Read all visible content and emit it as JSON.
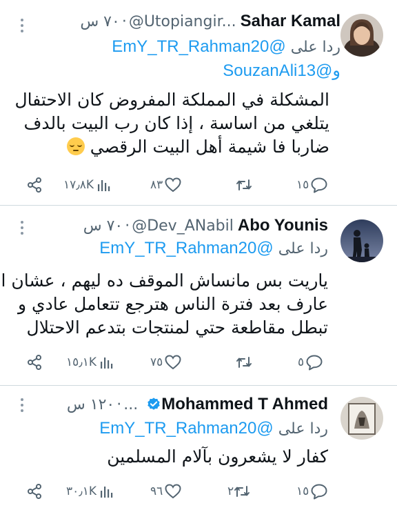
{
  "reply_prefix": "ردا على",
  "tweets": [
    {
      "name": "Sahar Kamal",
      "handle": "@Utopiangir...",
      "time": "٧٠ س",
      "verified": false,
      "reply_to": [
        "@EmY_TR_Rahman20",
        "و@SouzanAli13"
      ],
      "lines": [
        "المشكلة في المملكة المفروض كان الاحتفال",
        "يتلغي من اساسة ، إذا كان رب البيت بالدف",
        "ضاربا فا شيمة أهل البيت الرقصي"
      ],
      "emoji": "pensive-face-emoji",
      "views": "١٧٫٨K",
      "likes": "٨٣",
      "retweets": "",
      "replies": "١٥"
    },
    {
      "name": "Abo Younis",
      "handle": "@Dev_ANabil",
      "time": "٧٠ س",
      "verified": false,
      "reply_to": [
        "@EmY_TR_Rahman20"
      ],
      "lines": [
        "ياريت بس مانساش الموقف ده ليهم ، عشان انا",
        "عارف بعد فترة الناس هترجع تتعامل عادي و",
        "تبطل مقاطعة حتي لمنتجات بتدعم الاحتلال"
      ],
      "emoji": "",
      "views": "١٥٫١K",
      "likes": "٧٥",
      "retweets": "",
      "replies": "٥"
    },
    {
      "name": "Mohammed T Ahmed",
      "handle": "...",
      "time": "١٢٠ س",
      "verified": true,
      "reply_to": [
        "@EmY_TR_Rahman20"
      ],
      "lines": [
        "كفار لا يشعرون بآلام المسلمين"
      ],
      "emoji": "",
      "views": "٣٠٫١K",
      "likes": "٩٦",
      "retweets": "٢",
      "replies": "١٥"
    }
  ],
  "icons": {
    "views": "bar-chart-icon",
    "like": "heart-icon",
    "retweet": "retweet-icon",
    "reply": "speech-bubble-icon",
    "share": "share-icon",
    "more": "more-dots-icon",
    "verified": "verified-badge-icon"
  },
  "colors": {
    "link": "#1d9bf0",
    "secondary": "#536471",
    "text": "#0f1419",
    "divider": "#cfd9de",
    "verified": "#1d9bf0"
  }
}
